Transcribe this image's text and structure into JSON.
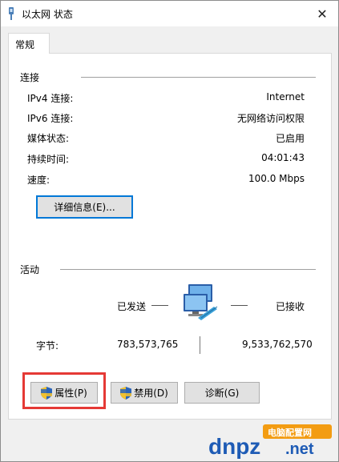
{
  "window": {
    "title": "以太网 状态",
    "close_glyph": "✕"
  },
  "tabs": [
    {
      "label": "常规"
    }
  ],
  "connection": {
    "heading": "连接",
    "rows": [
      {
        "label": "IPv4 连接:",
        "value": "Internet"
      },
      {
        "label": "IPv6 连接:",
        "value": "无网络访问权限"
      },
      {
        "label": "媒体状态:",
        "value": "已启用"
      },
      {
        "label": "持续时间:",
        "value": "04:01:43"
      },
      {
        "label": "速度:",
        "value": "100.0 Mbps"
      }
    ],
    "details_button": "详细信息(E)..."
  },
  "activity": {
    "heading": "活动",
    "sent_label": "已发送",
    "received_label": "已接收",
    "bytes_label": "字节:",
    "bytes_sent": "783,573,765",
    "bytes_received": "9,533,762,570"
  },
  "buttons": {
    "properties": "属性(P)",
    "disable": "禁用(D)",
    "diagnose": "诊断(G)"
  },
  "watermark": {
    "brand_top": "电脑配置网",
    "brand_main": "dnpz",
    "brand_tld": ".net"
  },
  "colors": {
    "highlight": "#e53935",
    "focus": "#0078d7",
    "brand_blue": "#1e5bb5",
    "brand_orange": "#f39c12"
  }
}
